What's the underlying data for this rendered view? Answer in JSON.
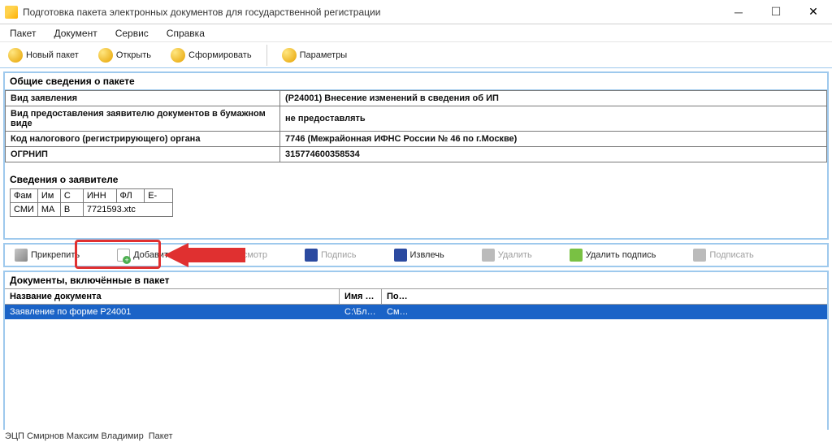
{
  "window": {
    "title": "Подготовка пакета электронных документов для государственной регистрации"
  },
  "menu": {
    "m0": "Пакет",
    "m1": "Документ",
    "m2": "Сервис",
    "m3": "Справка"
  },
  "toolbar": {
    "new": "Новый пакет",
    "open": "Открыть",
    "form": "Сформировать",
    "params": "Параметры"
  },
  "info": {
    "heading": "Общие сведения о пакете",
    "r1k": "Вид заявления",
    "r1v": "(Р24001) Внесение изменений в сведения об ИП",
    "r2k": "Вид предоставления заявителю документов в бумажном виде",
    "r2v": "не предоставлять",
    "r3k": "Код налогового (регистрирующего) органа",
    "r3v": "7746 (Межрайонная ИФНС России № 46 по г.Москве)",
    "r4k": "ОГРНИП",
    "r4v": "315774600358534"
  },
  "applicant": {
    "heading": "Сведения о заявителе",
    "h0": "Фам",
    "h1": "Им",
    "h2": "С",
    "h3": "ИНН",
    "h4": "ФЛ",
    "h5": "Е-",
    "r1c0": "СМИ",
    "r1c1": "МА",
    "r1c2": "В",
    "r1c3": "7721593.xtc"
  },
  "doctoolbar": {
    "attach": "Прикрепить",
    "add": "Добавить",
    "view": "Просмотр",
    "sign": "Подпись",
    "extract": "Извлечь",
    "delete": "Удалить",
    "delsig": "Удалить подпись",
    "dosign": "Подписать"
  },
  "docs": {
    "heading": "Документы, включённые в пакет",
    "col_name": "Название документа",
    "col_file": "Имя …",
    "col_sign": "По…",
    "row_name": "Заявление по форме Р24001",
    "row_file": "С:\\Бл…",
    "row_sign": "См…"
  },
  "status": {
    "left": "ЭЦП Смирнов Максим Владимир",
    "right": "Пакет"
  }
}
